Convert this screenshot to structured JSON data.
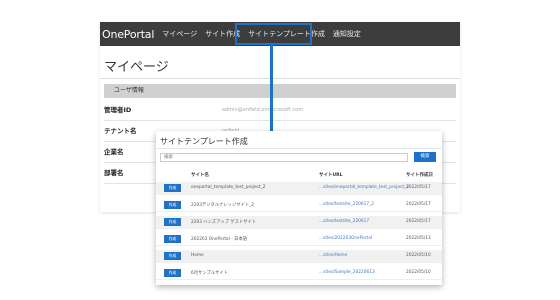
{
  "header": {
    "brand": "OnePortal",
    "nav": [
      "マイページ",
      "サイト作成",
      "サイトテンプレート作成",
      "通知設定"
    ]
  },
  "mypage": {
    "title": "マイページ",
    "section": "ユーザ情報",
    "fields": [
      {
        "label": "管理者ID",
        "value": "admin@onfield.onmicrosoft.com"
      },
      {
        "label": "テナント名",
        "value": "onfield"
      },
      {
        "label": "企業名",
        "value": ""
      },
      {
        "label": "部署名",
        "value": ""
      }
    ]
  },
  "template_panel": {
    "title": "サイトテンプレート作成",
    "search_value": "検索",
    "search_button": "検索",
    "columns": [
      "サイト名",
      "サイトURL",
      "サイト作成日"
    ],
    "row_button": "作成",
    "rows": [
      {
        "name": "oneportal_template_test_project_2",
        "url": "...sites/oneportal_template_test_project_2",
        "date": "2022/05/17"
      },
      {
        "name": "2203デジタルナレッジサイト_2",
        "url": "...sites/testsite_220617_2",
        "date": "2022/05/17"
      },
      {
        "name": "2203 ハンズアップ ゲストサイト",
        "url": "...sites/testsite_220617",
        "date": "2022/05/17"
      },
      {
        "name": "202203 OnePortal - 日本語",
        "url": "...sites/202203OnePortal",
        "date": "2022/05/13"
      },
      {
        "name": "Home",
        "url": "...sites/Home",
        "date": "2022/05/10"
      },
      {
        "name": "6月サンプルサイト",
        "url": "...sites/Sample_20220613",
        "date": "2022/05/10"
      }
    ]
  }
}
